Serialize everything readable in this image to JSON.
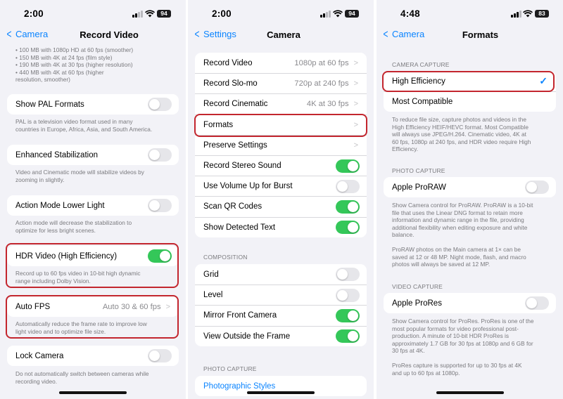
{
  "panel1": {
    "time": "2:00",
    "battery": "94",
    "back_label": "Camera",
    "title": "Record Video",
    "top_list": [
      "• 100 MB with 1080p HD at 60 fps (smoother)",
      "• 150 MB with 4K at 24 fps (film style)",
      "• 190 MB with 4K at 30 fps (higher resolution)",
      "• 440 MB with 4K at 60 fps (higher",
      "resolution, smoother)"
    ],
    "pal": {
      "label": "Show PAL Formats",
      "footer": [
        "PAL is a television video format used in many",
        "countries in Europe, Africa, Asia, and South America."
      ]
    },
    "stabilization": {
      "label": "Enhanced Stabilization",
      "footer": [
        "Video and Cinematic mode will stabilize videos by",
        "zooming in slightly."
      ]
    },
    "action": {
      "label": "Action Mode Lower Light",
      "footer": [
        "Action mode will decrease the stabilization to",
        "optimize for less bright scenes."
      ]
    },
    "hdr": {
      "label": "HDR Video (High Efficiency)",
      "footer": [
        "Record up to 60 fps video in 10-bit high dynamic",
        "range including Dolby Vision."
      ]
    },
    "autofps": {
      "label": "Auto FPS",
      "value": "Auto 30 & 60 fps",
      "footer": [
        "Automatically reduce the frame rate to improve low",
        "light video and to optimize file size."
      ]
    },
    "lock": {
      "label": "Lock Camera",
      "footer": [
        "Do not automatically switch between cameras while",
        "recording video."
      ]
    }
  },
  "panel2": {
    "time": "2:00",
    "battery": "94",
    "back_label": "Settings",
    "title": "Camera",
    "rows": [
      {
        "label": "Record Video",
        "value": "1080p at 60 fps"
      },
      {
        "label": "Record Slo-mo",
        "value": "720p at 240 fps"
      },
      {
        "label": "Record Cinematic",
        "value": "4K at 30 fps"
      },
      {
        "label": "Formats",
        "value": ""
      },
      {
        "label": "Preserve Settings",
        "value": ""
      },
      {
        "label": "Record Stereo Sound"
      },
      {
        "label": "Use Volume Up for Burst"
      },
      {
        "label": "Scan QR Codes"
      },
      {
        "label": "Show Detected Text"
      }
    ],
    "composition_header": "COMPOSITION",
    "composition": [
      {
        "label": "Grid"
      },
      {
        "label": "Level"
      },
      {
        "label": "Mirror Front Camera"
      },
      {
        "label": "View Outside the Frame"
      }
    ],
    "photo_header": "PHOTO CAPTURE",
    "photo_link": "Photographic Styles"
  },
  "panel3": {
    "time": "4:48",
    "battery": "83",
    "back_label": "Camera",
    "title": "Formats",
    "camera_capture_header": "CAMERA CAPTURE",
    "high_efficiency": "High Efficiency",
    "most_compatible": "Most Compatible",
    "capture_footer": [
      "To reduce file size, capture photos and videos in the",
      "High Efficiency HEIF/HEVC format. Most Compatible",
      "will always use JPEG/H.264. Cinematic video, 4K at",
      "60 fps, 1080p at 240 fps, and HDR video require High",
      "Efficiency."
    ],
    "photo_capture_header": "PHOTO CAPTURE",
    "proraw_label": "Apple ProRAW",
    "proraw_footer": [
      "Show Camera control for ProRAW. ProRAW is a 10-bit",
      "file that uses the Linear DNG format to retain more",
      "information and dynamic range in the file, providing",
      "additional flexibility when editing exposure and white",
      "balance."
    ],
    "proraw_footer2": [
      "ProRAW photos on the Main camera at 1× can be",
      "saved at 12 or 48 MP. Night mode, flash, and macro",
      "photos will always be saved at 12 MP."
    ],
    "video_capture_header": "VIDEO CAPTURE",
    "prores_label": "Apple ProRes",
    "prores_footer": [
      "Show Camera control for ProRes. ProRes is one of the",
      "most popular formats for video professional post-",
      "production. A minute of 10-bit HDR ProRes is",
      "approximately 1.7 GB for 30 fps at 1080p and 6 GB for",
      "30 fps at 4K."
    ],
    "prores_footer2": [
      "ProRes capture is supported for up to 30 fps at 4K",
      "and up to 60 fps at 1080p."
    ]
  },
  "colors": {
    "accent": "#0a84ff",
    "toggle_on": "#34c759",
    "highlight": "#c3262e",
    "background": "#f2f2f7"
  },
  "icons": {
    "signal": "signal-icon",
    "wifi": "wifi-icon",
    "battery": "battery-icon",
    "back": "chevron-left-icon",
    "disclosure": "chevron-right-icon",
    "check": "checkmark-icon"
  }
}
